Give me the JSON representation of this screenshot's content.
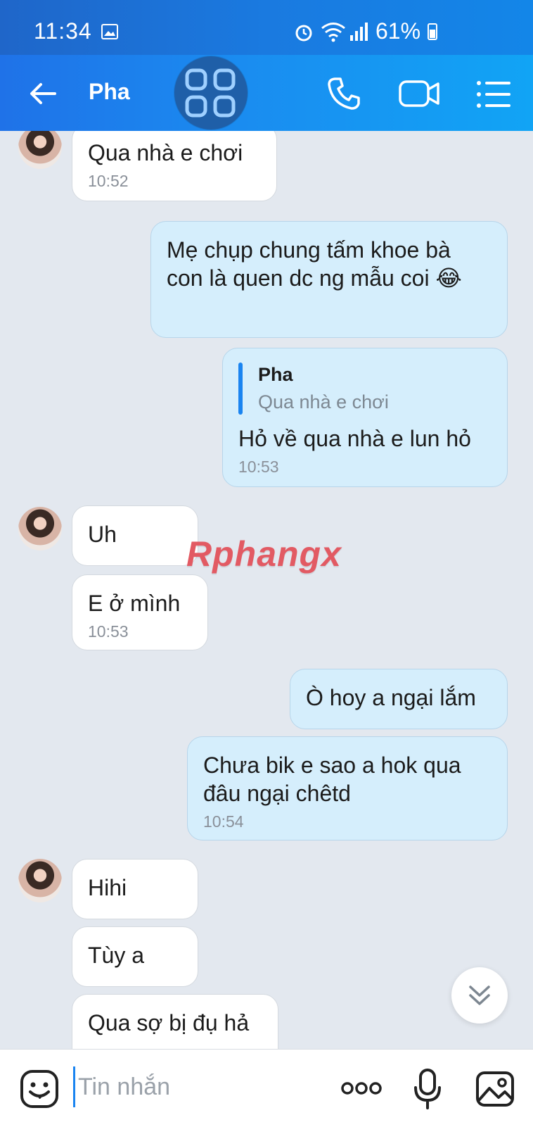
{
  "status_bar": {
    "time": "11:34",
    "battery": "61%"
  },
  "header": {
    "contact_name": "Pha"
  },
  "messages": [
    {
      "dir": "in",
      "text": "Qua nhà e chơi",
      "time": "10:52"
    },
    {
      "dir": "out",
      "text": "Mẹ chụp chung tấm khoe bà con là quen dc ng mẫu coi 😂",
      "time": ""
    },
    {
      "dir": "out",
      "quote_author": "Pha",
      "quote_text": "Qua nhà e chơi",
      "text": "Hỏ về qua nhà e lun hỏ",
      "time": "10:53"
    },
    {
      "dir": "in",
      "text": "Uh",
      "time": ""
    },
    {
      "dir": "in",
      "text": "E ở mình",
      "time": "10:53"
    },
    {
      "dir": "out",
      "text": "Ò hoy a ngại lắm",
      "time": ""
    },
    {
      "dir": "out",
      "text": "Chưa bik e sao a hok qua đâu ngại chêtd",
      "time": "10:54"
    },
    {
      "dir": "in",
      "text": "Hihi",
      "time": ""
    },
    {
      "dir": "in",
      "text": "Tùy a",
      "time": ""
    },
    {
      "dir": "in",
      "text": "Qua sợ bị đụ hả",
      "time": ""
    }
  ],
  "watermark": "Rphangx",
  "input": {
    "placeholder": "Tin nhắn",
    "value": ""
  },
  "colors": {
    "header_start": "#1f72e8",
    "header_end": "#11a4f5",
    "out_bubble": "#d5eefc",
    "in_bubble": "#ffffff",
    "accent": "#1a84f0"
  },
  "icons": [
    "back-arrow-icon",
    "apps-grid-icon",
    "phone-icon",
    "video-camera-icon",
    "list-menu-icon",
    "emoji-icon",
    "more-dots-icon",
    "microphone-icon",
    "image-icon",
    "chevron-double-down-icon"
  ]
}
